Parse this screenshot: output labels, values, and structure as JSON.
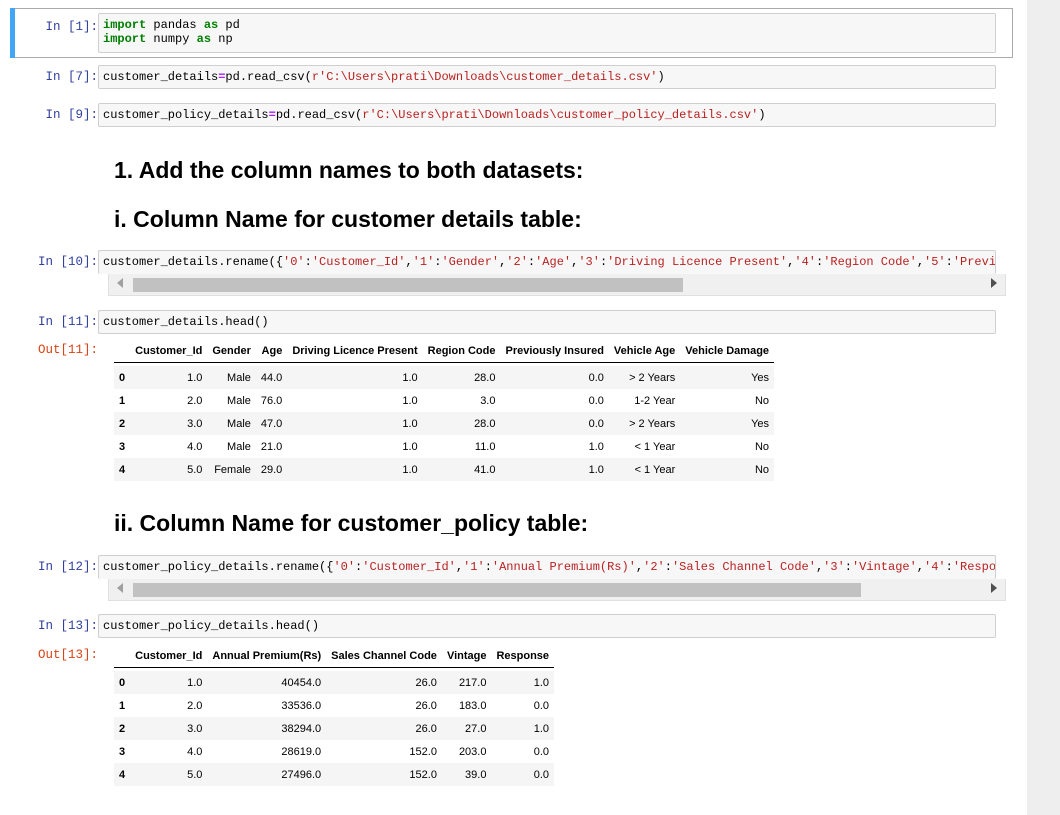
{
  "cells": [
    {
      "prompt": "In [1]:",
      "lines": [
        [
          "kw",
          "import"
        ],
        [
          "plain",
          " pandas "
        ],
        [
          "kw",
          "as"
        ],
        [
          "plain",
          " pd"
        ],
        [
          "nl",
          ""
        ],
        [
          "kw",
          "import"
        ],
        [
          "plain",
          " numpy "
        ],
        [
          "kw",
          "as"
        ],
        [
          "plain",
          " np"
        ]
      ]
    },
    {
      "prompt": "In [7]:",
      "code": [
        [
          "plain",
          "customer_details"
        ],
        [
          "op",
          "="
        ],
        [
          "plain",
          "pd.read_csv("
        ],
        [
          "str",
          "r'C:\\Users\\prati\\Downloads\\customer_details.csv'"
        ],
        [
          "plain",
          ")"
        ]
      ]
    },
    {
      "prompt": "In [9]:",
      "code": [
        [
          "plain",
          "customer_policy_details"
        ],
        [
          "op",
          "="
        ],
        [
          "plain",
          "pd.read_csv("
        ],
        [
          "str",
          "r'C:\\Users\\prati\\Downloads\\customer_policy_details.csv'"
        ],
        [
          "plain",
          ")"
        ]
      ]
    },
    {
      "prompt": "In [10]:",
      "code": [
        [
          "plain",
          "customer_details.rename({"
        ],
        [
          "str",
          "'0'"
        ],
        [
          "plain",
          ":"
        ],
        [
          "str",
          "'Customer_Id'"
        ],
        [
          "plain",
          ","
        ],
        [
          "str",
          "'1'"
        ],
        [
          "plain",
          ":"
        ],
        [
          "str",
          "'Gender'"
        ],
        [
          "plain",
          ","
        ],
        [
          "str",
          "'2'"
        ],
        [
          "plain",
          ":"
        ],
        [
          "str",
          "'Age'"
        ],
        [
          "plain",
          ","
        ],
        [
          "str",
          "'3'"
        ],
        [
          "plain",
          ":"
        ],
        [
          "str",
          "'Driving Licence Present'"
        ],
        [
          "plain",
          ","
        ],
        [
          "str",
          "'4'"
        ],
        [
          "plain",
          ":"
        ],
        [
          "str",
          "'Region Code'"
        ],
        [
          "plain",
          ","
        ],
        [
          "str",
          "'5'"
        ],
        [
          "plain",
          ":"
        ],
        [
          "str",
          "'Previously"
        ]
      ]
    },
    {
      "prompt": "In [11]:",
      "code": [
        [
          "plain",
          "customer_details.head()"
        ]
      ]
    },
    {
      "prompt": "In [12]:",
      "code": [
        [
          "plain",
          "customer_policy_details.rename({"
        ],
        [
          "str",
          "'0'"
        ],
        [
          "plain",
          ":"
        ],
        [
          "str",
          "'Customer_Id'"
        ],
        [
          "plain",
          ","
        ],
        [
          "str",
          "'1'"
        ],
        [
          "plain",
          ":"
        ],
        [
          "str",
          "'Annual Premium(Rs)'"
        ],
        [
          "plain",
          ","
        ],
        [
          "str",
          "'2'"
        ],
        [
          "plain",
          ":"
        ],
        [
          "str",
          "'Sales Channel Code'"
        ],
        [
          "plain",
          ","
        ],
        [
          "str",
          "'3'"
        ],
        [
          "plain",
          ":"
        ],
        [
          "str",
          "'Vintage'"
        ],
        [
          "plain",
          ","
        ],
        [
          "str",
          "'4'"
        ],
        [
          "plain",
          ":"
        ],
        [
          "str",
          "'Response'"
        ],
        [
          "plain",
          "}"
        ]
      ]
    },
    {
      "prompt": "In [13]:",
      "code": [
        [
          "plain",
          "customer_policy_details.head()"
        ]
      ]
    }
  ],
  "outputs": {
    "out11": "Out[11]:",
    "out13": "Out[13]:"
  },
  "headings": {
    "h1": "1. Add the column names to both datasets:",
    "h2": "i. Column Name for customer details table:",
    "h3": "ii. Column Name for customer_policy table:"
  },
  "table1": {
    "columns": [
      "Customer_Id",
      "Gender",
      "Age",
      "Driving Licence Present",
      "Region Code",
      "Previously Insured",
      "Vehicle Age",
      "Vehicle Damage"
    ],
    "rows": [
      {
        "idx": "0",
        "cells": [
          "1.0",
          "Male",
          "44.0",
          "1.0",
          "28.0",
          "0.0",
          "> 2 Years",
          "Yes"
        ]
      },
      {
        "idx": "1",
        "cells": [
          "2.0",
          "Male",
          "76.0",
          "1.0",
          "3.0",
          "0.0",
          "1-2 Year",
          "No"
        ]
      },
      {
        "idx": "2",
        "cells": [
          "3.0",
          "Male",
          "47.0",
          "1.0",
          "28.0",
          "0.0",
          "> 2 Years",
          "Yes"
        ]
      },
      {
        "idx": "3",
        "cells": [
          "4.0",
          "Male",
          "21.0",
          "1.0",
          "11.0",
          "1.0",
          "< 1 Year",
          "No"
        ]
      },
      {
        "idx": "4",
        "cells": [
          "5.0",
          "Female",
          "29.0",
          "1.0",
          "41.0",
          "1.0",
          "< 1 Year",
          "No"
        ]
      }
    ]
  },
  "table2": {
    "columns": [
      "Customer_Id",
      "Annual Premium(Rs)",
      "Sales Channel Code",
      "Vintage",
      "Response"
    ],
    "rows": [
      {
        "idx": "0",
        "cells": [
          "1.0",
          "40454.0",
          "26.0",
          "217.0",
          "1.0"
        ]
      },
      {
        "idx": "1",
        "cells": [
          "2.0",
          "33536.0",
          "26.0",
          "183.0",
          "0.0"
        ]
      },
      {
        "idx": "2",
        "cells": [
          "3.0",
          "38294.0",
          "26.0",
          "27.0",
          "1.0"
        ]
      },
      {
        "idx": "3",
        "cells": [
          "4.0",
          "28619.0",
          "152.0",
          "203.0",
          "0.0"
        ]
      },
      {
        "idx": "4",
        "cells": [
          "5.0",
          "27496.0",
          "152.0",
          "39.0",
          "0.0"
        ]
      }
    ]
  }
}
